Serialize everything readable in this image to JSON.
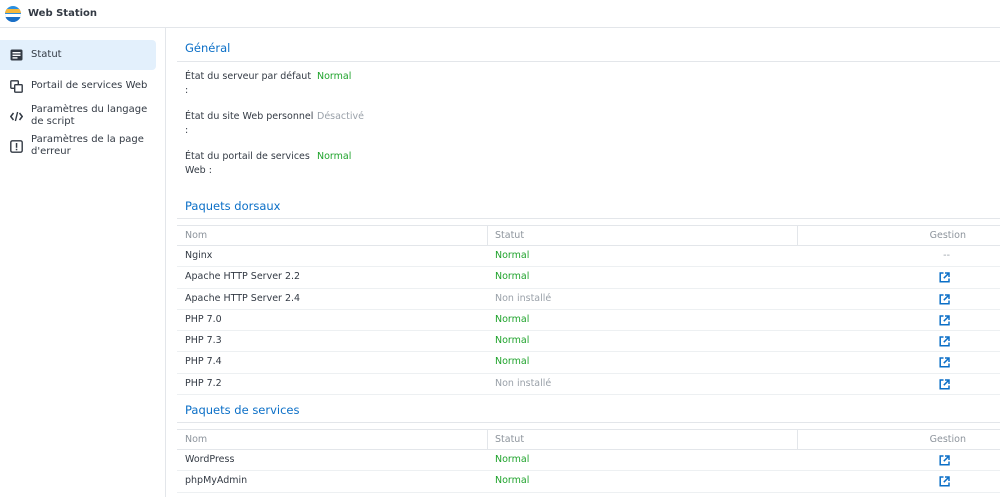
{
  "app": {
    "title": "Web Station",
    "icon": "web-station-logo"
  },
  "sidebar": {
    "items": [
      {
        "label": "Statut",
        "icon": "status-icon",
        "active": true
      },
      {
        "label": "Portail de services Web",
        "icon": "portal-icon"
      },
      {
        "label": "Paramètres du langage de script",
        "icon": "code-icon"
      },
      {
        "label": "Paramètres de la page d'erreur",
        "icon": "alert-icon"
      }
    ]
  },
  "general": {
    "title": "Général",
    "rows": [
      {
        "label": "État du serveur par défaut :",
        "value": "Normal",
        "tone": "green"
      },
      {
        "label": "État du site Web personnel :",
        "value": "Désactivé",
        "tone": "grey"
      },
      {
        "label": "État du portail de services Web :",
        "value": "Normal",
        "tone": "green"
      }
    ]
  },
  "backend": {
    "title": "Paquets dorsaux",
    "headers": {
      "name": "Nom",
      "status": "Statut",
      "manage": "Gestion"
    },
    "rows": [
      {
        "name": "Nginx",
        "status": "Normal",
        "tone": "green",
        "manage": "--"
      },
      {
        "name": "Apache HTTP Server 2.2",
        "status": "Normal",
        "tone": "green",
        "manage": "open-external-icon"
      },
      {
        "name": "Apache HTTP Server 2.4",
        "status": "Non installé",
        "tone": "grey",
        "manage": "open-external-icon"
      },
      {
        "name": "PHP 7.0",
        "status": "Normal",
        "tone": "green",
        "manage": "open-external-icon"
      },
      {
        "name": "PHP 7.3",
        "status": "Normal",
        "tone": "green",
        "manage": "open-external-icon"
      },
      {
        "name": "PHP 7.4",
        "status": "Normal",
        "tone": "green",
        "manage": "open-external-icon"
      },
      {
        "name": "PHP 7.2",
        "status": "Non installé",
        "tone": "grey",
        "manage": "open-external-icon"
      }
    ]
  },
  "services": {
    "title": "Paquets de services",
    "headers": {
      "name": "Nom",
      "status": "Statut",
      "manage": "Gestion"
    },
    "rows": [
      {
        "name": "WordPress",
        "status": "Normal",
        "tone": "green",
        "manage": "open-external-icon"
      },
      {
        "name": "phpMyAdmin",
        "status": "Normal",
        "tone": "green",
        "manage": "open-external-icon"
      }
    ]
  },
  "colors": {
    "accent": "#0b6fc7",
    "ok": "#1fa32c",
    "muted": "#9aa1a9",
    "active_bg": "#e3f0fc"
  }
}
